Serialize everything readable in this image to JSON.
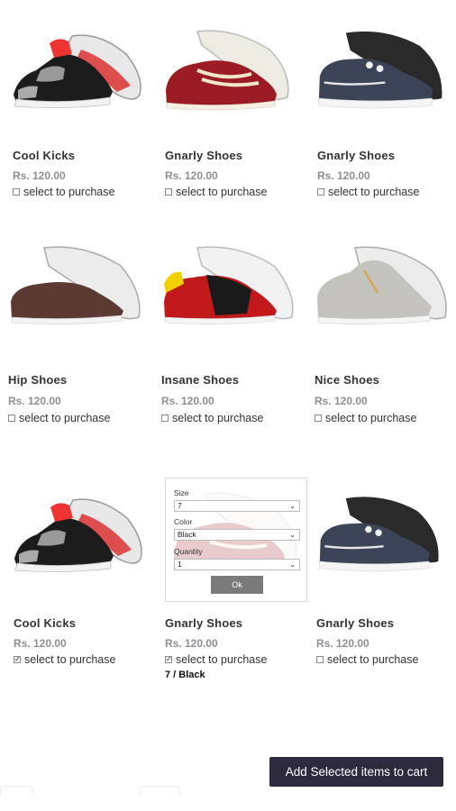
{
  "products": [
    {
      "name": "Cool Kicks",
      "price": "Rs. 120.00",
      "select_label": "select to purchase",
      "checked": false,
      "icon": "black-red-sneaker"
    },
    {
      "name": "Gnarly Shoes",
      "price": "Rs. 120.00",
      "select_label": "select to purchase",
      "checked": false,
      "icon": "red-cream-sneaker"
    },
    {
      "name": "Gnarly Shoes",
      "price": "Rs. 120.00",
      "select_label": "select to purchase",
      "checked": false,
      "icon": "navy-boat-shoe"
    },
    {
      "name": "Hip Shoes",
      "price": "Rs. 120.00",
      "select_label": "select to purchase",
      "checked": false,
      "icon": "brown-low-sneaker"
    },
    {
      "name": "Insane Shoes",
      "price": "Rs. 120.00",
      "select_label": "select to purchase",
      "checked": false,
      "icon": "red-black-yellow-sneaker"
    },
    {
      "name": "Nice Shoes",
      "price": "Rs. 120.00",
      "select_label": "select to purchase",
      "checked": false,
      "icon": "grey-high-top"
    },
    {
      "name": "Cool Kicks",
      "price": "Rs. 120.00",
      "select_label": "select to purchase",
      "checked": true,
      "icon": "black-red-sneaker"
    },
    {
      "name": "Gnarly Shoes",
      "price": "Rs. 120.00",
      "select_label": "select to purchase",
      "checked": true,
      "variant": "7 / Black",
      "icon": "red-cream-sneaker"
    },
    {
      "name": "Gnarly Shoes",
      "price": "Rs. 120.00",
      "select_label": "select to purchase",
      "checked": false,
      "icon": "navy-boat-shoe"
    }
  ],
  "popup": {
    "size_label": "Size",
    "size_value": "7",
    "color_label": "Color",
    "color_value": "Black",
    "quantity_label": "Quantity",
    "quantity_value": "1",
    "ok_label": "Ok"
  },
  "cart_button": "Add Selected items to cart",
  "colors": {
    "button_bg": "#2d2a3d",
    "price": "#8a8f95",
    "ok_bg": "#7a7a7a"
  }
}
